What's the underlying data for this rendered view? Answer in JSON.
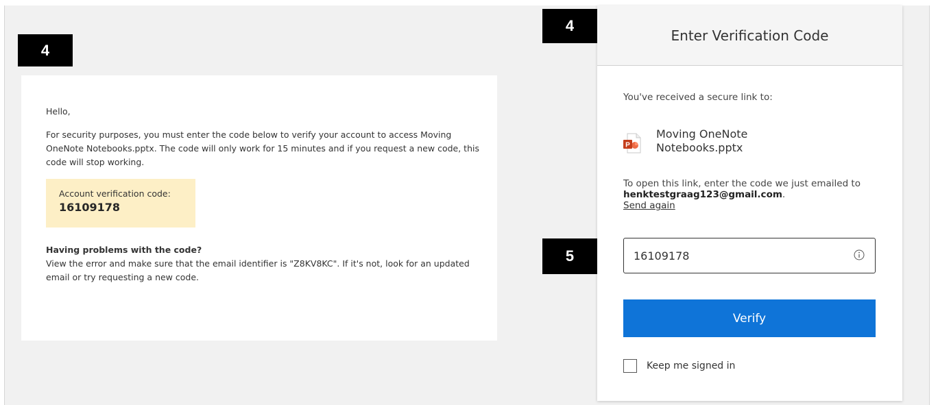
{
  "badges": {
    "email_step": "4",
    "dialog_step": "4",
    "input_step": "5"
  },
  "email": {
    "greeting": "Hello,",
    "body": "For security purposes, you must enter the code below to verify your account to access Moving OneNote Notebooks.pptx. The code will only work for 15 minutes and if you request a new code, this code will stop working.",
    "code_label": "Account verification code:",
    "code_value": "16109178",
    "problem_title": "Having problems with the code?",
    "problem_text": "View the error and make sure that the email identifier is \"Z8KV8KC\". If it's not, look for an updated email or try requesting a new code."
  },
  "dialog": {
    "title": "Enter Verification Code",
    "received_text": "You've received a secure link to:",
    "file_icon": "powerpoint-file-icon",
    "file_name": "Moving OneNote Notebooks.pptx",
    "instructions_prefix": "To open this link, enter the code we just emailed to ",
    "email_address": "henktestgraag123@gmail.com",
    "instructions_suffix": ".",
    "send_again": "Send again",
    "code_input_value": "16109178",
    "info_icon": "info-icon",
    "verify_label": "Verify",
    "keep_signed_in_label": "Keep me signed in"
  },
  "colors": {
    "verify_button": "#0f74d8",
    "code_box": "#fdefc6",
    "badge": "#000000",
    "ppt_red": "#d24726"
  }
}
